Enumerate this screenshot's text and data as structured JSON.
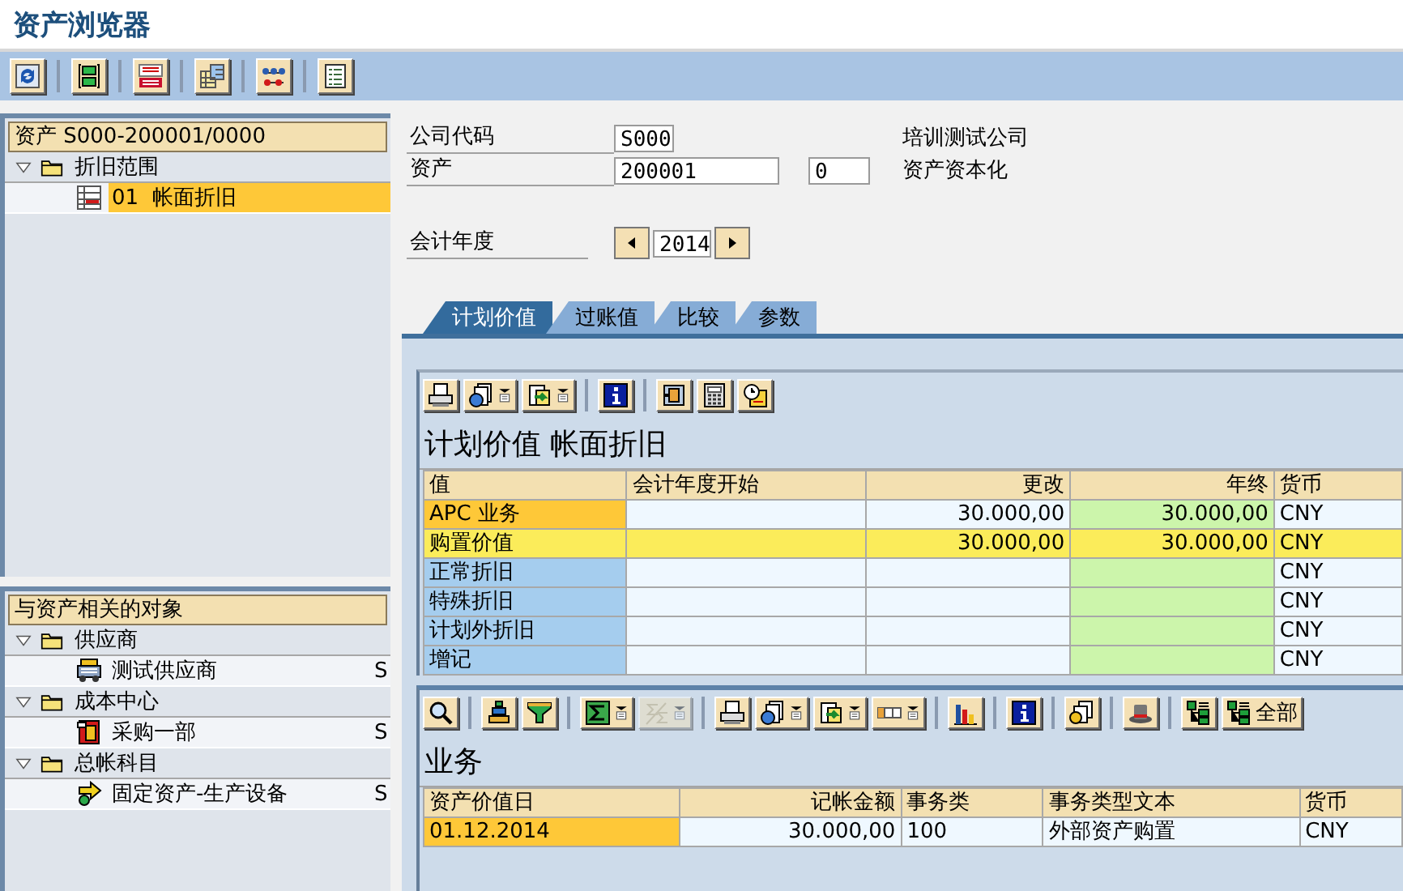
{
  "window": {
    "title": "资产浏览器"
  },
  "toolbar": {
    "buttons": [
      {
        "kind": "refresh"
      },
      {
        "kind": "separator"
      },
      {
        "kind": "page"
      },
      {
        "kind": "separator"
      },
      {
        "kind": "table"
      },
      {
        "kind": "separator"
      },
      {
        "kind": "grid"
      },
      {
        "kind": "separator"
      },
      {
        "kind": "network"
      },
      {
        "kind": "separator"
      },
      {
        "kind": "list"
      }
    ]
  },
  "asset_tree": {
    "header": "资产 S000-200001/0000",
    "items": [
      {
        "label": "折旧范围",
        "expanded": true,
        "children": [
          {
            "label": "01  帐面折旧",
            "selected": true
          }
        ]
      }
    ]
  },
  "related_objects": {
    "header": "与资产相关的对象",
    "groups": [
      {
        "label": "供应商",
        "expanded": true,
        "children": [
          {
            "kind": "vendor",
            "label": "测试供应商",
            "column_2": "S"
          }
        ]
      },
      {
        "label": "成本中心",
        "expanded": true,
        "children": [
          {
            "kind": "cost_center",
            "label": "采购一部",
            "column_2": "S"
          }
        ]
      },
      {
        "label": "总帐科目",
        "expanded": true,
        "children": [
          {
            "kind": "account",
            "label": "固定资产-生产设备",
            "column_2": "S"
          }
        ]
      }
    ]
  },
  "form": {
    "company_code": {
      "label": "公司代码",
      "value": "S000",
      "text": "培训测试公司"
    },
    "asset": {
      "label": "资产",
      "value": "200001",
      "sub_number": "0",
      "text": "资产资本化"
    },
    "fiscal_year": {
      "label": "会计年度",
      "value": "2014"
    }
  },
  "tabs": [
    {
      "label": "计划价值",
      "selected": true
    },
    {
      "label": "过账值",
      "selected": false
    },
    {
      "label": "比较",
      "selected": false
    },
    {
      "label": "参数",
      "selected": false
    }
  ],
  "values_grid": {
    "toolbar": [
      {
        "kind": "print"
      },
      {
        "kind": "detail",
        "menu": true
      },
      {
        "kind": "export",
        "menu": true
      },
      {
        "kind": "separator"
      },
      {
        "kind": "info"
      },
      {
        "kind": "separator"
      },
      {
        "kind": "layout"
      },
      {
        "kind": "calculator"
      },
      {
        "kind": "clock"
      }
    ],
    "title": "计划价值 帐面折旧",
    "columns": [
      {
        "label": "值",
        "kind": "key"
      },
      {
        "label": "会计年度开始",
        "kind": "plain"
      },
      {
        "label": "更改",
        "kind": "amount"
      },
      {
        "label": "年终",
        "kind": "total"
      },
      {
        "label": "货币",
        "kind": "plain"
      }
    ],
    "rows": [
      {
        "cells": [
          "APC 业务",
          null,
          "30.000,00",
          "30.000,00",
          "CNY"
        ],
        "selected": true,
        "highlighted": false
      },
      {
        "cells": [
          "购置价值",
          null,
          "30.000,00",
          "30.000,00",
          "CNY"
        ],
        "selected": false,
        "highlighted": true
      },
      {
        "cells": [
          "正常折旧",
          null,
          null,
          null,
          "CNY"
        ],
        "selected": false,
        "highlighted": false
      },
      {
        "cells": [
          "特殊折旧",
          null,
          null,
          null,
          "CNY"
        ],
        "selected": false,
        "highlighted": false
      },
      {
        "cells": [
          "计划外折旧",
          null,
          null,
          null,
          "CNY"
        ],
        "selected": false,
        "highlighted": false
      },
      {
        "cells": [
          "增记",
          null,
          null,
          null,
          "CNY"
        ],
        "selected": false,
        "highlighted": false
      }
    ]
  },
  "transactions_grid": {
    "toolbar": [
      {
        "kind": "detail_view"
      },
      {
        "kind": "separator"
      },
      {
        "kind": "sort"
      },
      {
        "kind": "filter"
      },
      {
        "kind": "separator"
      },
      {
        "kind": "sum",
        "menu": true
      },
      {
        "kind": "subtotal",
        "menu": true,
        "disabled": true
      },
      {
        "kind": "separator"
      },
      {
        "kind": "print"
      },
      {
        "kind": "detail",
        "menu": true
      },
      {
        "kind": "export",
        "menu": true
      },
      {
        "kind": "layout_select",
        "menu": true
      },
      {
        "kind": "separator"
      },
      {
        "kind": "chart"
      },
      {
        "kind": "separator"
      },
      {
        "kind": "info"
      },
      {
        "kind": "separator"
      },
      {
        "kind": "documents"
      },
      {
        "kind": "separator"
      },
      {
        "kind": "hat"
      },
      {
        "kind": "separator"
      },
      {
        "kind": "tree"
      },
      {
        "kind": "tree",
        "label": "全部"
      }
    ],
    "title": "业务",
    "columns": [
      {
        "label": "资产价值日",
        "kind": "plain"
      },
      {
        "label": "记帐金额",
        "kind": "amount"
      },
      {
        "label": "事务类",
        "kind": "plain"
      },
      {
        "label": "事务类型文本",
        "kind": "plain"
      },
      {
        "label": "货币",
        "kind": "plain"
      }
    ],
    "rows": [
      {
        "cells": [
          "01.12.2014",
          "30.000,00",
          "100",
          "外部资产购置",
          "CNY"
        ],
        "selected": true,
        "highlighted": false
      }
    ]
  }
}
